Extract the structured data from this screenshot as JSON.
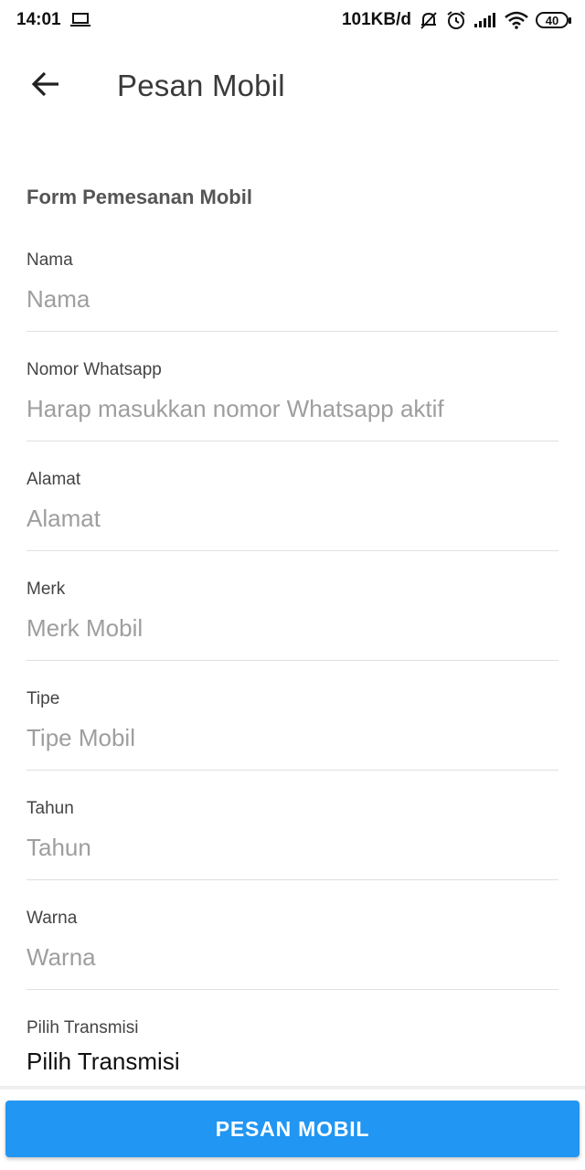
{
  "status_bar": {
    "time": "14:01",
    "net_speed": "101KB/d",
    "battery": "40",
    "icons": [
      "laptop-icon",
      "bell-off-icon",
      "alarm-icon",
      "signal-icon",
      "wifi-icon",
      "battery-icon"
    ]
  },
  "app_bar": {
    "back_icon": "arrow-left-icon",
    "title": "Pesan Mobil"
  },
  "form": {
    "heading": "Form Pemesanan Mobil",
    "fields": [
      {
        "label": "Nama",
        "placeholder": "Nama"
      },
      {
        "label": "Nomor Whatsapp",
        "placeholder": "Harap masukkan nomor Whatsapp aktif"
      },
      {
        "label": "Alamat",
        "placeholder": "Alamat"
      },
      {
        "label": "Merk",
        "placeholder": "Merk Mobil"
      },
      {
        "label": "Tipe",
        "placeholder": "Tipe Mobil"
      },
      {
        "label": "Tahun",
        "placeholder": "Tahun"
      },
      {
        "label": "Warna",
        "placeholder": "Warna"
      }
    ],
    "transmission": {
      "label": "Pilih Transmisi",
      "value": "Pilih Transmisi"
    }
  },
  "submit": {
    "label": "PESAN MOBIL"
  },
  "colors": {
    "accent": "#2196f3",
    "divider": "#e0e0e0",
    "placeholder": "#9e9e9e"
  }
}
